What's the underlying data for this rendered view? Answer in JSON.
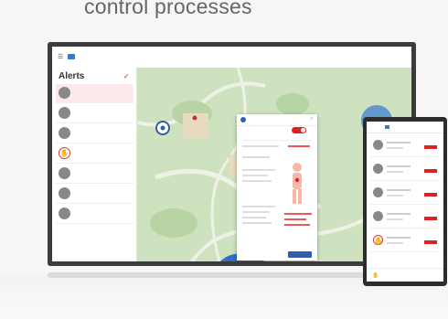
{
  "headline": "control processes",
  "topbar": {
    "app_name": "",
    "nav": [
      "",
      "",
      "",
      ""
    ]
  },
  "sidebar": {
    "title": "Alerts",
    "alerts": [
      {
        "name": "",
        "sub": "",
        "badge": "",
        "tag": "",
        "avatar": "person",
        "selected": true
      },
      {
        "name": "",
        "sub": "",
        "badge": "",
        "tag": "",
        "avatar": "person",
        "selected": false
      },
      {
        "name": "",
        "sub": "",
        "badge": "",
        "tag": "",
        "avatar": "person",
        "selected": false
      },
      {
        "name": "",
        "sub": "",
        "badge": "",
        "tag": "",
        "avatar": "hand",
        "selected": false
      },
      {
        "name": "",
        "sub": "",
        "badge": "",
        "tag": "",
        "avatar": "person",
        "selected": false
      },
      {
        "name": "",
        "sub": "",
        "badge": "",
        "tag": "",
        "avatar": "person",
        "selected": false
      },
      {
        "name": "",
        "sub": "",
        "badge": "",
        "tag": "",
        "avatar": "person",
        "selected": false
      }
    ]
  },
  "panel": {
    "title": "",
    "status": "",
    "button": ""
  },
  "tablet": {
    "title": "",
    "rows": [
      {
        "avatar": "person"
      },
      {
        "avatar": "person"
      },
      {
        "avatar": "person"
      },
      {
        "avatar": "person"
      },
      {
        "avatar": "hand"
      }
    ]
  },
  "colors": {
    "accent": "#2f5fb3",
    "alert": "#d22222",
    "map_green": "#cfe2c0",
    "map_water": "#2f6fc8"
  }
}
